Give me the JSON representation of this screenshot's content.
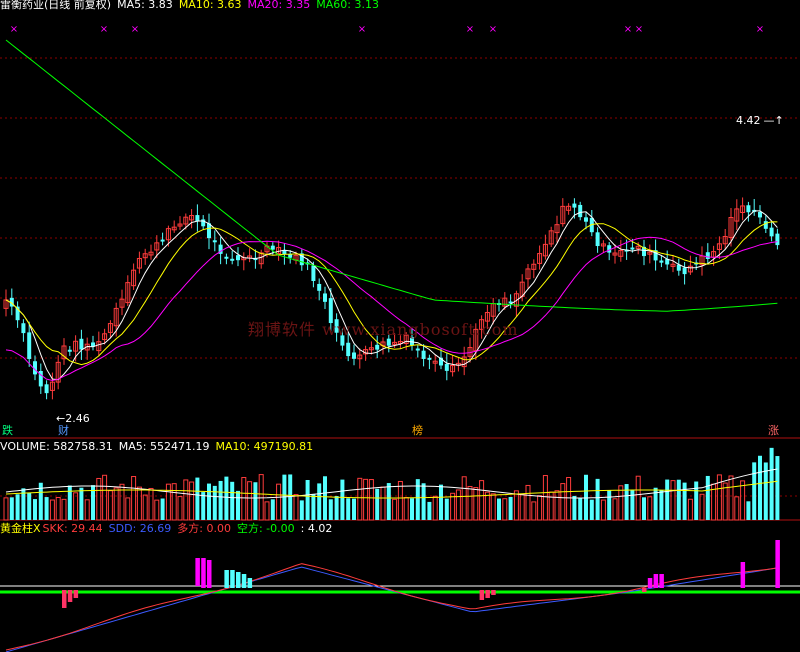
{
  "main_header": {
    "stock": "雷衡药业(日线 前复权)",
    "ma5": "MA5: 3.83",
    "ma10": "MA10: 3.63",
    "ma20": "MA20: 3.35",
    "ma60": "MA60: 3.13"
  },
  "volume_header": {
    "title": "VOLUME: 582758.31",
    "ma5": "MA5: 552471.19",
    "ma10": "MA10: 497190.81"
  },
  "indicator_header": {
    "title": "黄金柱X",
    "skk": "SKK: 29.44",
    "sdd": "SDD: 26.69",
    "duo": "多方: 0.00",
    "kong": "空方: -0.00",
    "last": ": 4.02"
  },
  "annotations": {
    "high_label": "4.42",
    "low_label": "2.46",
    "marker_die": "跌",
    "marker_cai": "财",
    "marker_bang": "榜",
    "marker_zhang": "涨"
  },
  "watermark": "翔博软件 www.xiangbosoft.com",
  "colors": {
    "up": "#ff3c3c",
    "down": "#54ffff",
    "ma5": "#ffffff",
    "ma10": "#ffff00",
    "ma20": "#ff00ff",
    "ma60": "#00ff00",
    "grid": "#8b0000"
  },
  "chart_data": [
    {
      "type": "candlestick",
      "title": "雷衡药业(日线 前复权)",
      "series": [
        {
          "name": "MA5",
          "last": 3.83
        },
        {
          "name": "MA10",
          "last": 3.63
        },
        {
          "name": "MA20",
          "last": 3.35
        },
        {
          "name": "MA60",
          "last": 3.13
        }
      ],
      "annotations": [
        {
          "label": "4.42",
          "type": "period-high"
        },
        {
          "label": "2.46",
          "type": "period-low"
        }
      ],
      "grid": true
    },
    {
      "type": "bar",
      "title": "VOLUME",
      "series": [
        {
          "name": "VOLUME",
          "last": 582758.31
        },
        {
          "name": "MA5",
          "last": 552471.19
        },
        {
          "name": "MA10",
          "last": 497190.81
        }
      ]
    },
    {
      "type": "bar",
      "title": "黄金柱X",
      "series": [
        {
          "name": "SKK",
          "last": 29.44
        },
        {
          "name": "SDD",
          "last": 26.69
        },
        {
          "name": "多方",
          "last": 0.0
        },
        {
          "name": "空方",
          "last": -0.0
        }
      ]
    }
  ]
}
